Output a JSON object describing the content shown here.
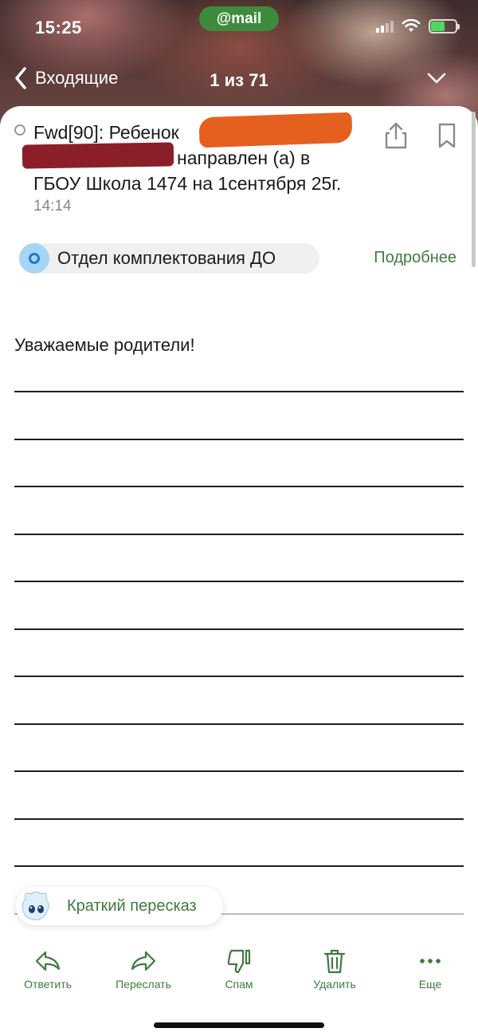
{
  "status_bar": {
    "time": "15:25",
    "app_pill": "@mail"
  },
  "nav": {
    "back_label": "Входящие",
    "counter": "1 из 71"
  },
  "message": {
    "subject_line1": "Fwd[90]: Ребенок",
    "subject_line2": "направлен (а) в",
    "subject_line3": "ГБОУ Школа 1474 на 1сентября 25г.",
    "time": "14:14",
    "sender": "Отдел комплектования ДО",
    "details_link": "Подробнее",
    "greeting": "Уважаемые родители!"
  },
  "summary": {
    "label": "Краткий пересказ"
  },
  "toolbar": {
    "reply": "Ответить",
    "forward": "Переслать",
    "spam": "Спам",
    "delete": "Удалить",
    "more": "Еще"
  },
  "colors": {
    "accent": "#3f7a3f",
    "pill": "#3d8b3d",
    "redact_orange": "#e5601f",
    "redact_dark": "#8a1f2a"
  },
  "icons": [
    "back-chevron-icon",
    "chevron-down-icon",
    "share-icon",
    "bookmark-icon",
    "reply-icon",
    "forward-icon",
    "thumbs-down-icon",
    "trash-icon",
    "more-icon",
    "mascot-icon"
  ]
}
